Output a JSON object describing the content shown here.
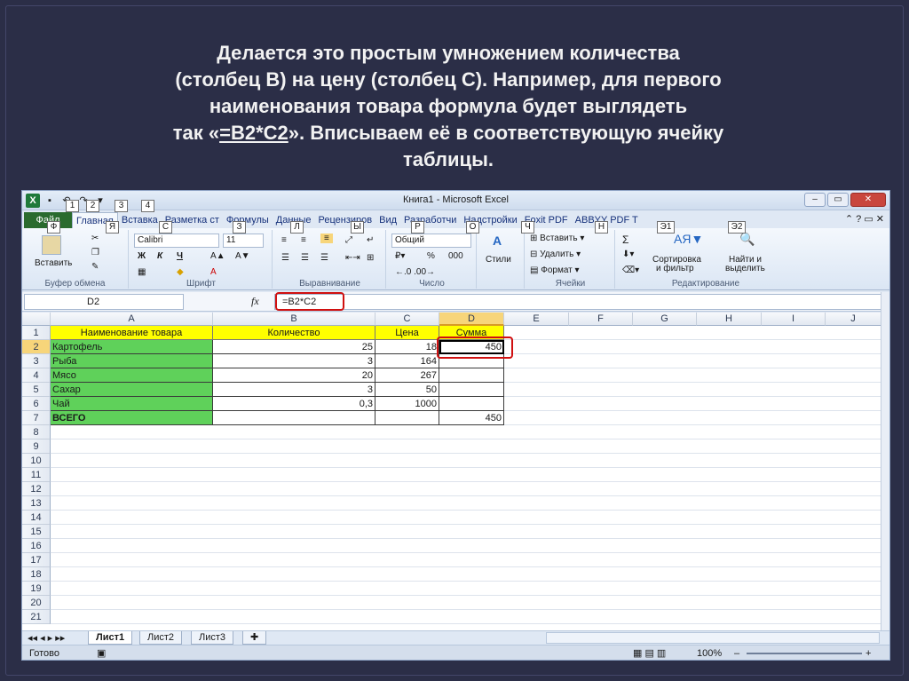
{
  "slide": {
    "caption_line1": "Делается это простым умножением количества",
    "caption_line2": "(столбец В) на цену (столбец С). Например, для первого",
    "caption_line3": "наименования товара формула будет выглядеть",
    "caption_line4_pre": "так «",
    "caption_line4_formula": "=B2*C2",
    "caption_line4_post": "». Вписываем её в соответствующую ячейку",
    "caption_line5": "таблицы."
  },
  "window": {
    "title": "Книга1 - Microsoft Excel",
    "minimize": "–",
    "maximize": "▭",
    "close": "✕"
  },
  "keytips": {
    "k1": "1",
    "k2": "2",
    "k3": "3",
    "k4": "4",
    "file": "Ф",
    "home": "Я",
    "insert": "С",
    "layout": "З",
    "formulas": "Л",
    "data": "Ы",
    "review": "Р",
    "view": "О",
    "dev": "Ч",
    "addins": "Н",
    "foxit": "Э1",
    "abbyy": "Э2"
  },
  "tabs": [
    "Файл",
    "Главная",
    "Вставка",
    "Разметка ст",
    "Формулы",
    "Данные",
    "Рецензиров",
    "Вид",
    "Разработчи",
    "Надстройки",
    "Foxit PDF",
    "ABBYY PDF T"
  ],
  "ribbon": {
    "paste": "Вставить",
    "clipboard": "Буфер обмена",
    "font_name": "Calibri",
    "font_size": "11",
    "bold": "Ж",
    "italic": "К",
    "underline": "Ч",
    "font_group": "Шрифт",
    "align_group": "Выравнивание",
    "number_format": "Общий",
    "percent": "%",
    "thousands": "000",
    "number_group": "Число",
    "styles": "Стили",
    "insert": "Вставить",
    "delete": "Удалить",
    "format": "Формат",
    "cells_group": "Ячейки",
    "sigma": "Σ",
    "sort": "Сортировка",
    "sort2": "и фильтр",
    "find": "Найти и",
    "find2": "выделить",
    "editing_group": "Редактирование"
  },
  "formula_bar": {
    "name_box": "D2",
    "fx": "fx",
    "formula": "=B2*C2"
  },
  "columns": [
    "A",
    "B",
    "C",
    "D",
    "E",
    "F",
    "G",
    "H",
    "I",
    "J"
  ],
  "rows": [
    "1",
    "2",
    "3",
    "4",
    "5",
    "6",
    "7",
    "8",
    "9",
    "10",
    "11",
    "12",
    "13",
    "14",
    "15",
    "16",
    "17",
    "18",
    "19",
    "20",
    "21"
  ],
  "table": {
    "headers": [
      "Наименование товара",
      "Количество",
      "Цена",
      "Сумма"
    ],
    "rows": [
      [
        "Картофель",
        "25",
        "18",
        "450"
      ],
      [
        "Рыба",
        "3",
        "164",
        ""
      ],
      [
        "Мясо",
        "20",
        "267",
        ""
      ],
      [
        "Сахар",
        "3",
        "50",
        ""
      ],
      [
        "Чай",
        "0,3",
        "1000",
        ""
      ],
      [
        "ВСЕГО",
        "",
        "",
        "450"
      ]
    ]
  },
  "sheets": [
    "Лист1",
    "Лист2",
    "Лист3"
  ],
  "status": {
    "ready": "Готово",
    "zoom": "100%",
    "minus": "–",
    "plus": "+"
  },
  "colors": {
    "header_yellow": "#ffff00",
    "name_green": "#5fd15a",
    "highlight_red": "#d01010",
    "slide_bg": "#2b2e47"
  }
}
